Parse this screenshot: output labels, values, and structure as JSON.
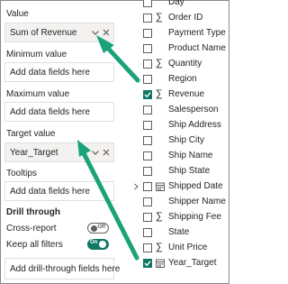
{
  "left_pane": {
    "value_label": "Value",
    "value_field": "Sum of Revenue",
    "min_label": "Minimum value",
    "min_placeholder": "Add data fields here",
    "max_label": "Maximum value",
    "max_placeholder": "Add data fields here",
    "target_label": "Target value",
    "target_field": "Year_Target",
    "tooltips_label": "Tooltips",
    "tooltips_placeholder": "Add data fields here",
    "drill_label": "Drill through",
    "cross_report_label": "Cross-report",
    "cross_report_state": "Off",
    "keep_filters_label": "Keep all filters",
    "keep_filters_state": "On",
    "drill_placeholder": "Add drill-through fields here"
  },
  "fields": [
    {
      "name": "Day",
      "sigma": false,
      "calendar": false,
      "checked": false,
      "expander": false
    },
    {
      "name": "Order ID",
      "sigma": true,
      "calendar": false,
      "checked": false,
      "expander": false
    },
    {
      "name": "Payment Type",
      "sigma": false,
      "calendar": false,
      "checked": false,
      "expander": false
    },
    {
      "name": "Product Name",
      "sigma": false,
      "calendar": false,
      "checked": false,
      "expander": false
    },
    {
      "name": "Quantity",
      "sigma": true,
      "calendar": false,
      "checked": false,
      "expander": false
    },
    {
      "name": "Region",
      "sigma": false,
      "calendar": false,
      "checked": false,
      "expander": false
    },
    {
      "name": "Revenue",
      "sigma": true,
      "calendar": false,
      "checked": true,
      "expander": false
    },
    {
      "name": "Salesperson",
      "sigma": false,
      "calendar": false,
      "checked": false,
      "expander": false
    },
    {
      "name": "Ship Address",
      "sigma": false,
      "calendar": false,
      "checked": false,
      "expander": false
    },
    {
      "name": "Ship City",
      "sigma": false,
      "calendar": false,
      "checked": false,
      "expander": false
    },
    {
      "name": "Ship Name",
      "sigma": false,
      "calendar": false,
      "checked": false,
      "expander": false
    },
    {
      "name": "Ship State",
      "sigma": false,
      "calendar": false,
      "checked": false,
      "expander": false
    },
    {
      "name": "Shipped Date",
      "sigma": false,
      "calendar": true,
      "checked": false,
      "expander": true
    },
    {
      "name": "Shipper Name",
      "sigma": false,
      "calendar": false,
      "checked": false,
      "expander": false
    },
    {
      "name": "Shipping Fee",
      "sigma": true,
      "calendar": false,
      "checked": false,
      "expander": false
    },
    {
      "name": "State",
      "sigma": false,
      "calendar": false,
      "checked": false,
      "expander": false
    },
    {
      "name": "Unit Price",
      "sigma": true,
      "calendar": false,
      "checked": false,
      "expander": false
    },
    {
      "name": "Year_Target",
      "sigma": false,
      "calendar": true,
      "checked": true,
      "expander": false
    }
  ],
  "colors": {
    "accent": "#117865",
    "arrow": "#1aa37a"
  },
  "icons": {
    "well_dropdown": "chevron-down-icon",
    "well_remove": "close-icon",
    "numeric_field": "sigma-icon",
    "date_field": "calendar-icon",
    "expand": "chevron-right-icon"
  }
}
